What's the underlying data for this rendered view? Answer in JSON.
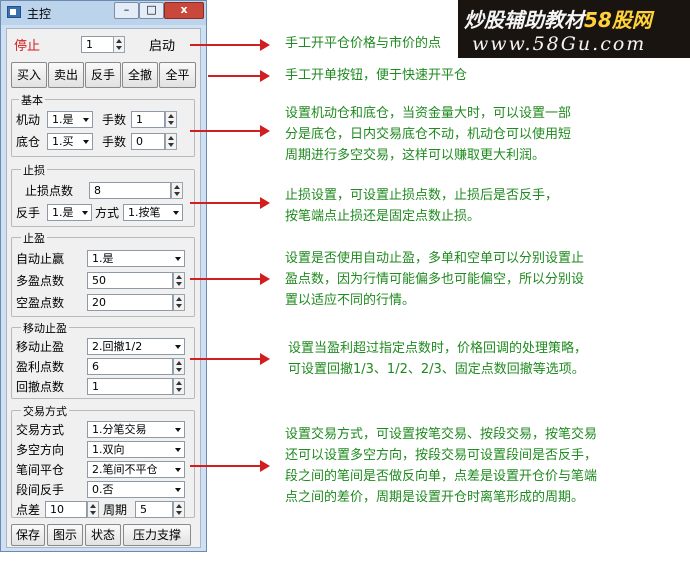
{
  "window": {
    "title": "主控",
    "minimize_glyph": "–",
    "maximize_glyph": "□",
    "close_glyph": "x"
  },
  "control_row": {
    "stop_label": "停止",
    "qty_value": "1",
    "start_label": "启动"
  },
  "order_buttons": [
    "买入",
    "卖出",
    "反手",
    "全撤",
    "全平"
  ],
  "basic": {
    "title": "基本",
    "mobile_label": "机动",
    "mobile_value": "1.是",
    "lots_label": "手数",
    "mobile_lots": "1",
    "base_label": "底仓",
    "base_value": "1.买",
    "base_lots": "0"
  },
  "stoploss": {
    "title": "止损",
    "points_label": "止损点数",
    "points_value": "8",
    "reverse_label": "反手",
    "reverse_value": "1.是",
    "mode_label": "方式",
    "mode_value": "1.按笔"
  },
  "takeprofit": {
    "title": "止盈",
    "auto_label": "自动止赢",
    "auto_value": "1.是",
    "long_label": "多盈点数",
    "long_value": "50",
    "short_label": "空盈点数",
    "short_value": "20"
  },
  "trailing": {
    "title": "移动止盈",
    "mode_label": "移动止盈",
    "mode_value": "2.回撤1/2",
    "profit_label": "盈利点数",
    "profit_value": "6",
    "retrace_label": "回撤点数",
    "retrace_value": "1"
  },
  "trade_mode": {
    "title": "交易方式",
    "mode_label": "交易方式",
    "mode_value": "1.分笔交易",
    "direction_label": "多空方向",
    "direction_value": "1.双向",
    "close_label": "笔间平仓",
    "close_value": "2.笔间不平仓",
    "reverse_label": "段间反手",
    "reverse_value": "0.否",
    "spread_label": "点差",
    "spread_value": "10",
    "period_label": "周期",
    "period_value": "5"
  },
  "bottom_buttons": [
    "保存",
    "图示",
    "状态",
    "压力支撑"
  ],
  "notes": {
    "n1": [
      "手工开平仓价格与市价的点"
    ],
    "n2": [
      "手工开单按钮，便于快速开平仓"
    ],
    "n3": [
      "设置机动仓和底仓，当资金量大时，可以设置一部",
      "分是底仓，日内交易底仓不动，机动仓可以使用短",
      "周期进行多空交易，这样可以赚取更大利润。"
    ],
    "n4": [
      "止损设置，可设置止损点数，止损后是否反手，",
      "按笔端点止损还是固定点数止损。"
    ],
    "n5": [
      "设置是否使用自动止盈，多单和空单可以分别设置止",
      "盈点数，因为行情可能偏多也可能偏空，所以分别设",
      "置以适应不同的行情。"
    ],
    "n6": [
      "设置当盈利超过指定点数时，价格回调的处理策略，",
      "可设置回撤1/3、1/2、2/3、固定点数回撤等选项。"
    ],
    "n7": [
      "设置交易方式，可设置按笔交易、按段交易，按笔交易",
      "还可以设置多空方向，按段交易可设置段间是否反手，",
      "段之间的笔间是否做反向单，点差是设置开仓价与笔端",
      "点之间的差价，周期是设置开仓时离笔形成的周期。"
    ]
  },
  "banner": {
    "line1_prefix": "炒股辅助教材",
    "line1_brand": "58股网",
    "line2": "www.58Gu.com"
  },
  "colors": {
    "arrow": "#d21e1e",
    "note_text": "#1f8a1f",
    "stop_text": "#d21e1e",
    "window_frame": "#cfe0f2"
  }
}
